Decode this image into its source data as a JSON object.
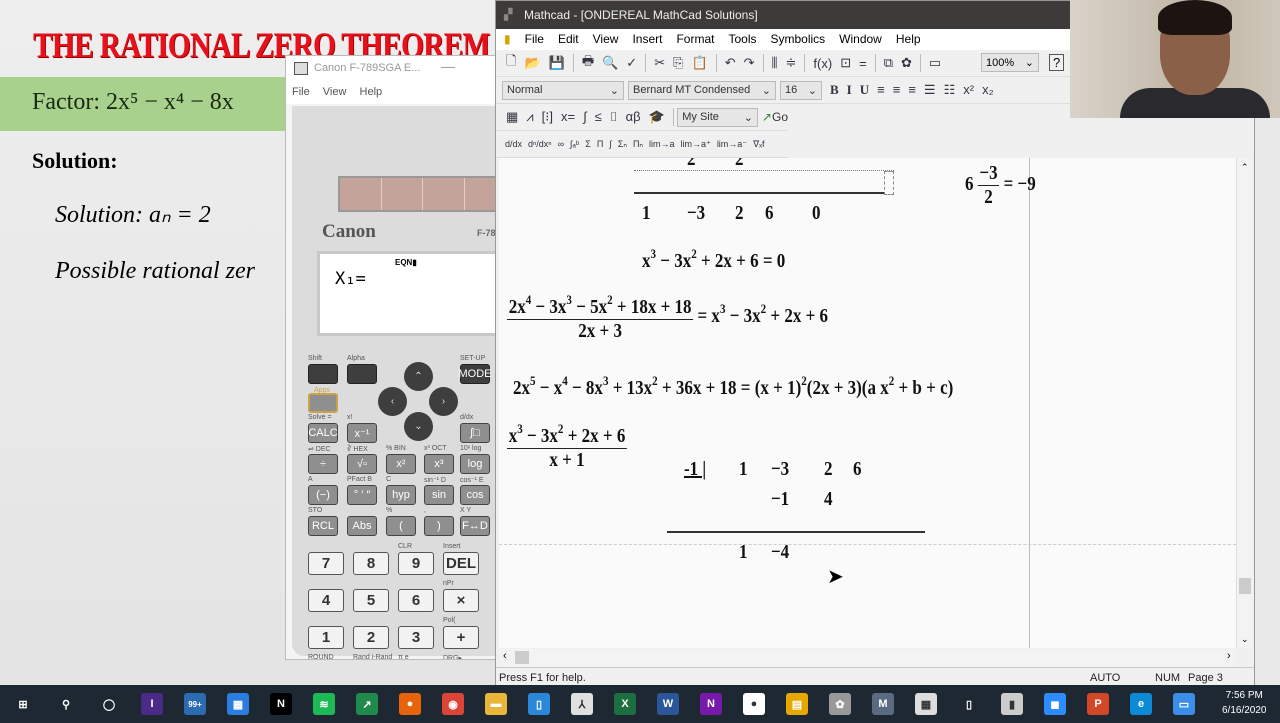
{
  "slide": {
    "title": "THE RATIONAL ZERO THEOREM",
    "factor": "Factor:  2x⁵ − x⁴ − 8x",
    "solution_heading": "Solution:",
    "solution_an": "Solution:   aₙ = 2",
    "possible": "Possible rational zer",
    "title_color": "#e8101a",
    "band_color": "#a9d18e"
  },
  "calculator": {
    "window_title": "Canon F-789SGA E...",
    "menu": [
      "File",
      "View",
      "Help"
    ],
    "brand": "Canon",
    "model": "F-789",
    "lcd_indicator": "EQN▮",
    "lcd_text": "X₁=",
    "top_keys": [
      {
        "label": "",
        "top": "Shift"
      },
      {
        "label": "",
        "top": "Alpha"
      },
      {
        "label": "MODE",
        "top": "SET-UP"
      }
    ],
    "apps_label": "Apps",
    "fn_rows": [
      [
        {
          "label": "CALC",
          "top": "Solve ="
        },
        {
          "label": "x⁻¹",
          "top": "x!"
        },
        {
          "label": "",
          "top": ""
        },
        {
          "label": "",
          "top": ""
        },
        {
          "label": "∫□",
          "top": "d/dx"
        }
      ],
      [
        {
          "label": "÷",
          "top": "⇌ DEC"
        },
        {
          "label": "√▫",
          "top": "∛ HEX"
        },
        {
          "label": "x²",
          "top": "% BIN"
        },
        {
          "label": "x³",
          "top": "x³ OCT"
        },
        {
          "label": "log",
          "top": "10ˣ log"
        }
      ],
      [
        {
          "label": "(−)",
          "top": "A"
        },
        {
          "label": "° ′ ″",
          "top": "PFact B"
        },
        {
          "label": "hyp",
          "top": "C"
        },
        {
          "label": "sin",
          "top": "sin⁻¹ D"
        },
        {
          "label": "cos",
          "top": "cos⁻¹ E"
        }
      ],
      [
        {
          "label": "RCL",
          "top": "STO"
        },
        {
          "label": "Abs",
          "top": ""
        },
        {
          "label": "(",
          "top": "%"
        },
        {
          "label": ")",
          "top": ","
        },
        {
          "label": "F↔D",
          "top": "X Y"
        }
      ]
    ],
    "num_rows": [
      [
        {
          "label": "7",
          "top": ""
        },
        {
          "label": "8",
          "top": ""
        },
        {
          "label": "9",
          "top": "CLR"
        },
        {
          "label": "DEL",
          "top": "Insert"
        }
      ],
      [
        {
          "label": "4",
          "top": ""
        },
        {
          "label": "5",
          "top": ""
        },
        {
          "label": "6",
          "top": ""
        },
        {
          "label": "×",
          "top": "nPr"
        }
      ],
      [
        {
          "label": "1",
          "top": ""
        },
        {
          "label": "2",
          "top": ""
        },
        {
          "label": "3",
          "top": ""
        },
        {
          "label": "+",
          "top": "Pol("
        }
      ],
      [
        {
          "label": "0",
          "top": "ROUND"
        },
        {
          "label": "·",
          "top": "Rand i-Rand"
        },
        {
          "label": "EXP",
          "top": "π    e"
        },
        {
          "label": "Ans",
          "top": "DRG▸"
        }
      ]
    ]
  },
  "mathcad": {
    "window_title": "Mathcad - [ONDEREAL MathCad Solutions]",
    "menu": [
      "File",
      "Edit",
      "View",
      "Insert",
      "Format",
      "Tools",
      "Symbolics",
      "Window",
      "Help"
    ],
    "zoom": "100%",
    "style": "Normal",
    "font": "Bernard MT Condensed",
    "size": "16",
    "resource": "My Site",
    "go": "Go",
    "toolbar1_icons": [
      "new-icon",
      "open-icon",
      "save-icon",
      "print-icon",
      "print-preview-icon",
      "spellcheck-icon",
      "cut-icon",
      "copy-icon",
      "paste-icon",
      "undo-icon",
      "redo-icon",
      "align-across-icon",
      "align-down-icon",
      "insert-function-icon",
      "insert-unit-icon",
      "calculate-icon",
      "component-icon",
      "resource-icon",
      "region-icon"
    ],
    "format_icons": [
      {
        "n": "bold",
        "g": "B"
      },
      {
        "n": "italic",
        "g": "I"
      },
      {
        "n": "underline",
        "g": "U"
      },
      {
        "n": "align-left",
        "g": "≡"
      },
      {
        "n": "align-center",
        "g": "≡"
      },
      {
        "n": "align-right",
        "g": "≡"
      },
      {
        "n": "bullets",
        "g": "☰"
      },
      {
        "n": "numbering",
        "g": "☷"
      },
      {
        "n": "superscript",
        "g": "x²"
      },
      {
        "n": "subscript",
        "g": "x₂"
      }
    ],
    "math_icons": [
      {
        "n": "calculator",
        "g": "▦"
      },
      {
        "n": "graph",
        "g": "⩘"
      },
      {
        "n": "matrix",
        "g": "[⁝]"
      },
      {
        "n": "evaluation",
        "g": "x="
      },
      {
        "n": "calculus",
        "g": "∫"
      },
      {
        "n": "boolean",
        "g": "≤"
      },
      {
        "n": "programming",
        "g": "⌷"
      },
      {
        "n": "greek",
        "g": "αβ"
      },
      {
        "n": "symbolic",
        "g": "🎓"
      }
    ],
    "calculus_icons": [
      "d/dx",
      "dⁿ/dxⁿ",
      "∞",
      "∫ₐᵇ",
      "Σ",
      "Π",
      "∫",
      "Σₙ",
      "Πₙ",
      "lim→a",
      "lim→a⁺",
      "lim→a⁻",
      "∇ₓf"
    ],
    "sheet": {
      "top_partial": [
        "2",
        "2"
      ],
      "row1": [
        "1",
        "−3",
        "2",
        "6",
        "0"
      ],
      "eq1": [
        "x",
        "^3",
        " − 3x",
        "^2",
        " + 2x + 6 = 0"
      ],
      "side_lhs": "6",
      "side_num": "−3",
      "side_den": "2",
      "side_rhs": "= −9",
      "div_num": [
        "2x",
        "^4",
        " − 3x",
        "^3",
        " − 5x",
        "^2",
        " + 18x + 18"
      ],
      "div_den": "2x + 3",
      "div_rhs": [
        "= x",
        "^3",
        " − 3x",
        "^2",
        " + 2x + 6"
      ],
      "eq2": [
        "2x",
        "^5",
        " − x",
        "^4",
        " − 8x",
        "^3",
        " + 13x",
        "^2",
        " + 36x + 18 = (x + 1)",
        "^2",
        "(2x + 3)(a x",
        "^2",
        " + b + c)"
      ],
      "div2_num": [
        "x",
        "^3",
        " − 3x",
        "^2",
        " + 2x + 6"
      ],
      "div2_den": "x + 1",
      "synth_root": "-1 |",
      "synth_row1": [
        "1",
        "−3",
        "2",
        "6"
      ],
      "synth_row2": [
        "−1",
        "4"
      ],
      "synth_result": [
        "1",
        "−4"
      ]
    },
    "status": {
      "help": "Press F1 for help.",
      "auto": "AUTO",
      "num": "NUM",
      "page": "Page 3"
    }
  },
  "taskbar": {
    "icons": [
      {
        "n": "windows-start",
        "c": "#1e2833",
        "g": "⊞"
      },
      {
        "n": "search",
        "c": "#1e2833",
        "g": "⚲"
      },
      {
        "n": "cortana",
        "c": "#1e2833",
        "g": "◯"
      },
      {
        "n": "app-i",
        "c": "#4b2a8a",
        "g": "I"
      },
      {
        "n": "mail",
        "c": "#2b6cb0",
        "g": "99+"
      },
      {
        "n": "calendar",
        "c": "#2b7de0",
        "g": "▦"
      },
      {
        "n": "netflix",
        "c": "#000",
        "g": "N"
      },
      {
        "n": "spotify",
        "c": "#1db954",
        "g": "≋"
      },
      {
        "n": "stocks",
        "c": "#1f8a4c",
        "g": "↗"
      },
      {
        "n": "firefox",
        "c": "#e8630a",
        "g": "●"
      },
      {
        "n": "chrome",
        "c": "#db4437",
        "g": "◉"
      },
      {
        "n": "file-explorer",
        "c": "#e8b63a",
        "g": "▬"
      },
      {
        "n": "app-blue",
        "c": "#2b88d8",
        "g": "▯"
      },
      {
        "n": "acrobat",
        "c": "#e0e0e0",
        "g": "⅄"
      },
      {
        "n": "excel",
        "c": "#1d6f42",
        "g": "X"
      },
      {
        "n": "word",
        "c": "#2b579a",
        "g": "W"
      },
      {
        "n": "onenote",
        "c": "#7719aa",
        "g": "N"
      },
      {
        "n": "app-green",
        "c": "#fff",
        "g": "●"
      },
      {
        "n": "app-yellow",
        "c": "#e5a800",
        "g": "▤"
      },
      {
        "n": "app-gray",
        "c": "#999",
        "g": "✿"
      },
      {
        "n": "mathcad",
        "c": "#5a6a80",
        "g": "M"
      },
      {
        "n": "calculator",
        "c": "#ddd",
        "g": "▦"
      },
      {
        "n": "phone",
        "c": "#1e2833",
        "g": "▯"
      },
      {
        "n": "usb",
        "c": "#ccc",
        "g": "▮"
      },
      {
        "n": "zoom",
        "c": "#2d8cff",
        "g": "◼"
      },
      {
        "n": "powerpoint",
        "c": "#d24726",
        "g": "P"
      },
      {
        "n": "edge",
        "c": "#0c8ad6",
        "g": "e"
      },
      {
        "n": "app-window",
        "c": "#3a8ee6",
        "g": "▭"
      }
    ],
    "time": "7:56 PM",
    "date": "6/16/2020"
  }
}
